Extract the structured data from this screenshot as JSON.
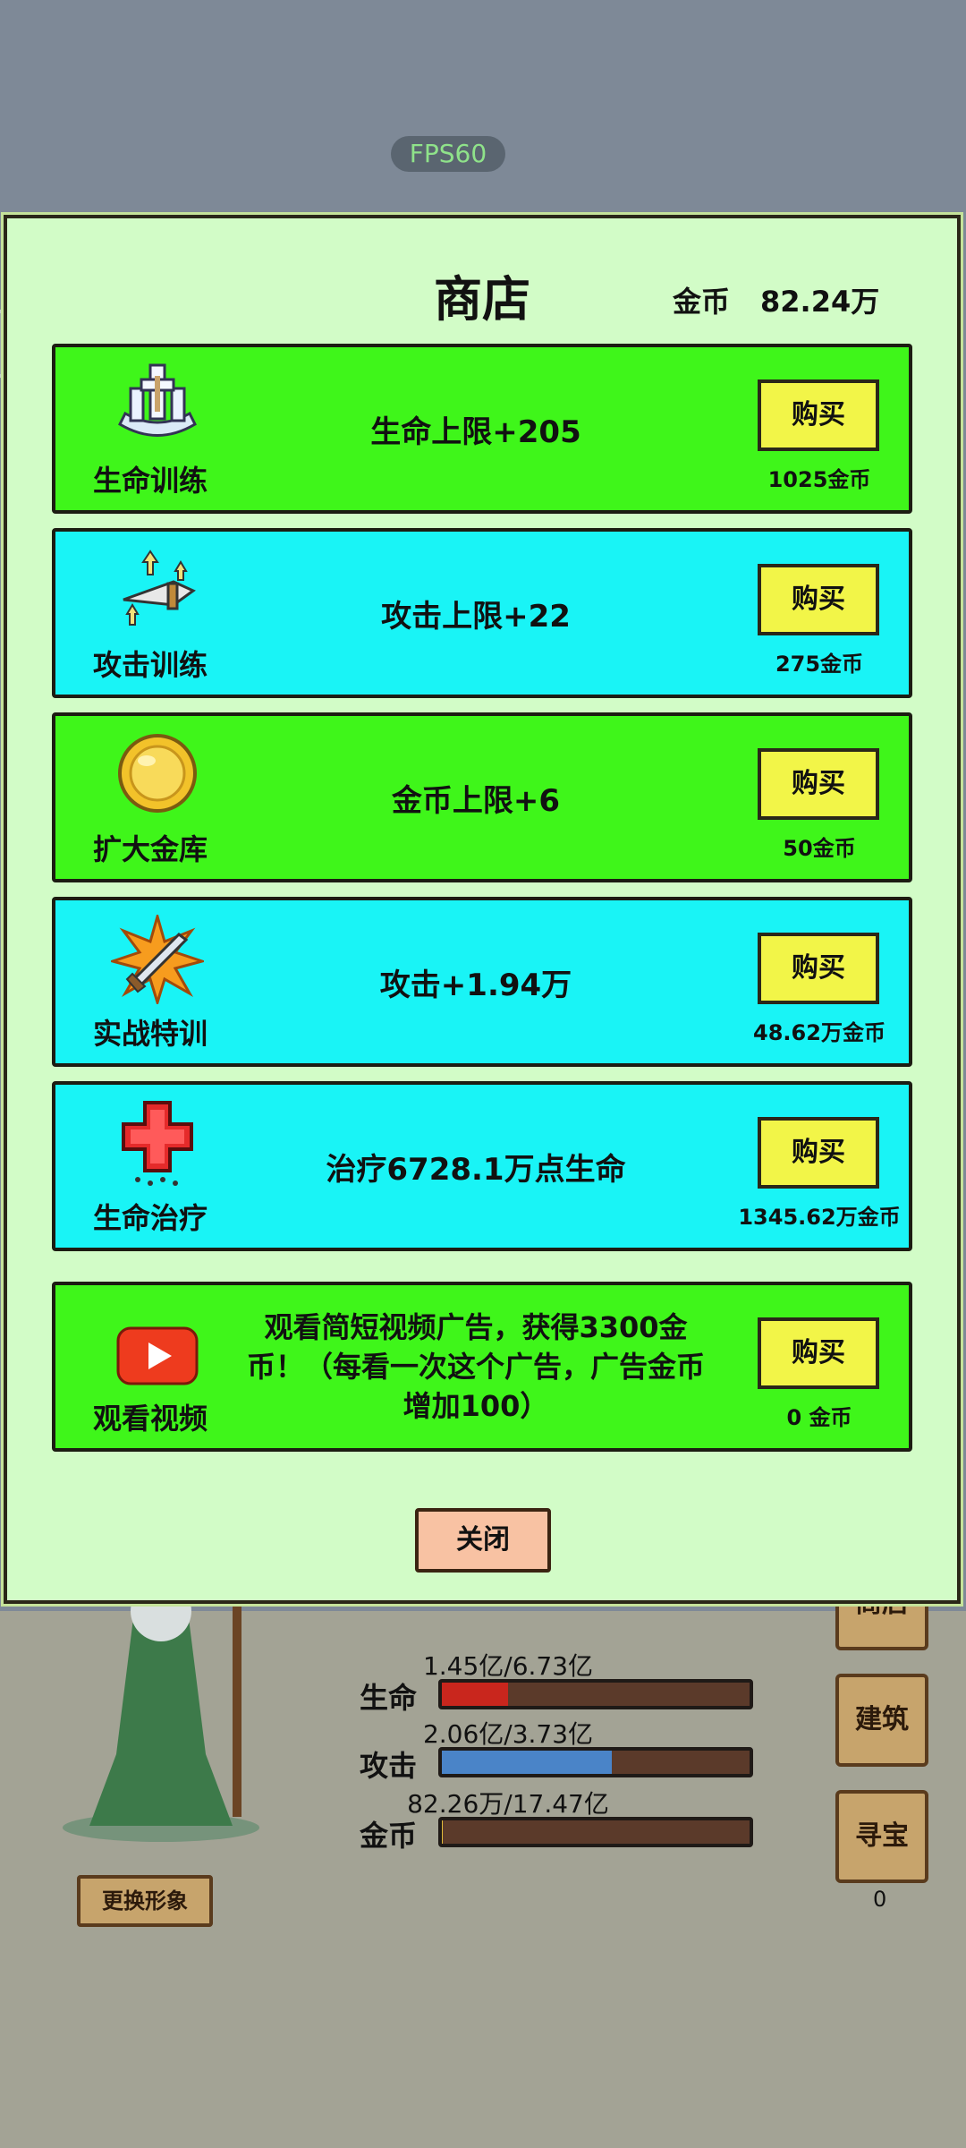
{
  "fps": "FPS60",
  "shop": {
    "title": "商店",
    "gold_label": "金币",
    "gold_value": "82.24万",
    "items": [
      {
        "name": "生命训练",
        "desc": "生命上限+205",
        "buy": "购买",
        "price": "1025金币",
        "color": "green",
        "icon": "life-training-icon"
      },
      {
        "name": "攻击训练",
        "desc": "攻击上限+22",
        "buy": "购买",
        "price": "275金币",
        "color": "cyan",
        "icon": "attack-training-icon"
      },
      {
        "name": "扩大金库",
        "desc": "金币上限+6",
        "buy": "购买",
        "price": "50金币",
        "color": "green",
        "icon": "gold-coin-icon"
      },
      {
        "name": "实战特训",
        "desc": "攻击+1.94万",
        "buy": "购买",
        "price": "48.62万金币",
        "color": "cyan",
        "icon": "combat-training-icon"
      },
      {
        "name": "生命治疗",
        "desc": "治疗6728.1万点生命",
        "buy": "购买",
        "price": "1345.62万金币",
        "color": "cyan",
        "icon": "healing-cross-icon"
      },
      {
        "name": "观看视频",
        "desc": "观看简短视频广告，获得3300金币！（每看一次这个广告，广告金币增加100）",
        "buy": "购买",
        "price": "0 金币",
        "color": "green",
        "icon": "video-play-icon"
      }
    ],
    "close": "关闭"
  },
  "hud": {
    "change_look": "更换形象",
    "life_label": "生命",
    "life_value": "1.45亿/6.73亿",
    "life_fraction": 0.215,
    "attack_label": "攻击",
    "attack_value": "2.06亿/3.73亿",
    "attack_fraction": 0.552,
    "gold_label": "金币",
    "gold_value": "82.26万/17.47亿",
    "gold_fraction": 0.0005,
    "buttons": {
      "shop": "商店",
      "build": "建筑",
      "treasure": "寻宝"
    },
    "treasure_count": "0"
  },
  "colors": {
    "green": "#3ff61a",
    "cyan": "#19f4f6",
    "buy": "#f2f548",
    "panel": "#d2fcc7"
  }
}
